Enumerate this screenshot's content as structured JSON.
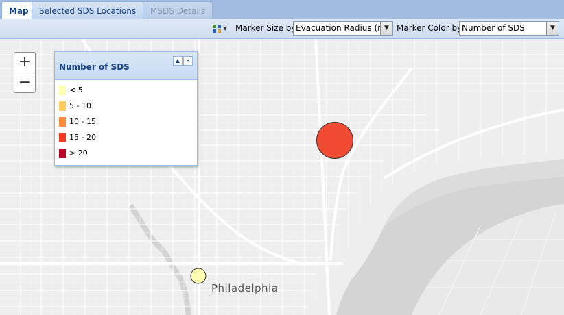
{
  "tabs": [
    {
      "label": "Map"
    },
    {
      "label": "Selected SDS Locations"
    },
    {
      "label": "MSDS Details"
    }
  ],
  "toolbar": {
    "layout_icon": "grid-layout-icon",
    "marker_size_label": "Marker Size by",
    "marker_size_value": "Evacuation Radius (m)",
    "marker_color_label": "Marker Color by",
    "marker_color_value": "Number of SDS"
  },
  "zoom": {
    "in": "+",
    "out": "−"
  },
  "legend": {
    "title": "Number of SDS",
    "items": [
      {
        "label": "< 5",
        "color": "#ffffb2"
      },
      {
        "label": "5 - 10",
        "color": "#fecc5c"
      },
      {
        "label": "10 - 15",
        "color": "#fd8d3c"
      },
      {
        "label": "15 - 20",
        "color": "#f03b20"
      },
      {
        "label": "> 20",
        "color": "#bd0026"
      }
    ]
  },
  "map": {
    "city_label": "Philadelphia",
    "markers": [
      {
        "color": "#f04a32",
        "size": "large"
      },
      {
        "color": "#ffffb2",
        "size": "small"
      }
    ]
  }
}
